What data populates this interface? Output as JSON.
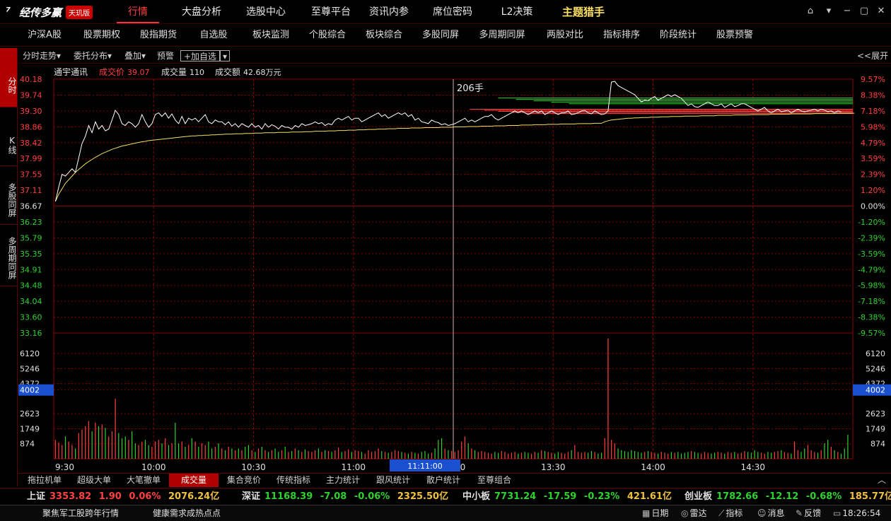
{
  "app": {
    "logo_text": "经传多赢",
    "badge": "天玑版"
  },
  "top_nav": [
    "行情",
    "大盘分析",
    "选股中心",
    "至尊平台",
    "资讯内参",
    "席位密码",
    "L2决策",
    "主题猎手"
  ],
  "sub_nav": [
    "沪深A股",
    "股票期权",
    "股指期货",
    "自选股",
    "板块监测",
    "个股综合",
    "板块综合",
    "多股同屏",
    "多周期同屏",
    "两股对比",
    "指标排序",
    "阶段统计",
    "股票预警"
  ],
  "left_tabs": [
    "分时",
    "K线",
    "多股同屏",
    "多周期同屏"
  ],
  "toolbar": {
    "fenshi": "分时走势",
    "weituo": "委托分布",
    "diejia": "叠加",
    "yujing": "预警",
    "add_self": "+加自选",
    "expand": "<<展开"
  },
  "info": {
    "stock_name": "通宇通讯",
    "price_label": "成交价",
    "price": "39.07",
    "volume_label": "成交量",
    "volume": "110",
    "amount_label": "成交额",
    "amount": "42.68万元"
  },
  "cursor": {
    "label": "206手",
    "time": "11:11:00"
  },
  "chart_data": {
    "type": "line",
    "title": "通宇通讯 分时走势",
    "prev_close": 36.67,
    "ylim": [
      33.16,
      40.18
    ],
    "price_ticks": [
      "40.18",
      "39.74",
      "39.30",
      "38.86",
      "38.42",
      "37.99",
      "37.55",
      "37.11",
      "36.67",
      "36.23",
      "35.79",
      "35.35",
      "34.91",
      "34.48",
      "34.04",
      "33.60",
      "33.16"
    ],
    "pct_ticks": [
      "9.57%",
      "8.38%",
      "7.18%",
      "5.98%",
      "4.79%",
      "3.59%",
      "2.39%",
      "1.20%",
      "0.00%",
      "-1.20%",
      "-2.39%",
      "-3.59%",
      "-4.79%",
      "-5.98%",
      "-7.18%",
      "-8.38%",
      "-9.57%"
    ],
    "volume_ticks": [
      "6120",
      "5246",
      "4372",
      "4002",
      "2623",
      "1749",
      "874"
    ],
    "volume_max": 6991,
    "x_ticks": [
      "9:30",
      "10:00",
      "10:30",
      "11:00",
      "13:00",
      "13:30",
      "14:00",
      "14:30"
    ],
    "minutes": 240,
    "price": [
      36.8,
      37.2,
      37.55,
      37.5,
      37.6,
      37.7,
      37.6,
      38.0,
      38.4,
      38.6,
      38.9,
      38.7,
      39.0,
      38.8,
      38.9,
      38.75,
      38.8,
      39.05,
      39.32,
      39.2,
      38.95,
      38.9,
      39.0,
      38.95,
      38.85,
      38.95,
      39.2,
      39.0,
      38.85,
      38.95,
      39.2,
      39.25,
      39.15,
      39.25,
      39.1,
      39.22,
      39.05,
      38.95,
      39.15,
      38.95,
      39.1,
      39.05,
      39.1,
      39.0,
      39.1,
      39.2,
      39.0,
      38.95,
      39.05,
      39.0,
      39.0,
      38.92,
      39.0,
      38.88,
      38.95,
      38.85,
      38.95,
      38.9,
      38.85,
      38.95,
      38.85,
      38.9,
      38.8,
      38.95,
      38.85,
      38.92,
      38.88,
      38.8,
      38.9,
      38.85,
      38.85,
      38.8,
      38.9,
      38.85,
      38.95,
      38.9,
      38.92,
      38.95,
      39.0,
      38.95,
      38.98,
      38.9,
      38.95,
      38.92,
      39.05,
      39.1,
      39.05,
      39.1,
      39.15,
      39.05,
      39.1,
      39.1,
      39.0,
      39.05,
      39.1,
      39.15,
      39.2,
      39.25,
      39.15,
      39.2,
      39.1,
      39.15,
      39.2,
      39.25,
      39.2,
      39.25,
      39.15,
      39.2,
      39.05,
      39.1,
      39.0,
      38.98,
      38.95,
      39.05,
      39.0,
      38.98,
      38.92,
      38.95,
      38.9,
      38.92,
      38.95,
      39.0,
      39.05,
      39.1,
      39.0,
      39.05,
      39.0,
      39.05,
      39.1,
      39.15,
      39.15,
      39.2,
      39.1,
      39.05,
      39.1,
      39.15,
      39.2,
      39.25,
      39.3,
      39.25,
      39.3,
      39.25,
      39.2,
      39.25,
      39.3,
      39.25,
      39.3,
      39.2,
      39.25,
      39.3,
      39.25,
      39.2,
      39.25,
      39.25,
      39.3,
      39.2,
      39.22,
      39.25,
      39.3,
      39.32,
      39.25,
      39.22,
      39.3,
      39.25,
      39.2,
      39.22,
      39.3,
      40.1,
      40.12,
      40.0,
      39.95,
      39.9,
      39.85,
      39.8,
      39.75,
      39.65,
      39.55,
      39.6,
      39.58,
      39.65,
      39.7,
      39.6,
      39.65,
      39.7,
      39.75,
      39.7,
      39.75,
      39.7,
      39.65,
      39.55,
      39.45,
      39.5,
      39.42,
      39.4,
      39.45,
      39.5,
      39.55,
      39.5,
      39.45,
      39.45,
      39.5,
      39.4,
      39.45,
      39.5,
      39.42,
      39.45,
      39.5,
      39.5,
      39.45,
      39.4,
      39.35,
      39.3,
      39.35,
      39.4,
      39.3,
      39.25,
      39.3,
      39.35,
      39.28,
      39.3,
      39.32,
      39.25,
      39.3,
      39.35,
      39.3,
      39.28,
      39.3,
      39.32,
      39.35,
      39.3,
      39.35,
      39.32,
      39.28,
      39.3,
      39.25,
      39.3,
      39.28
    ],
    "avg": [
      36.8,
      37.0,
      37.15,
      37.3,
      37.4,
      37.5,
      37.6,
      37.68,
      37.76,
      37.84,
      37.9,
      37.96,
      38.02,
      38.07,
      38.12,
      38.16,
      38.2,
      38.24,
      38.27,
      38.3,
      38.33,
      38.35,
      38.37,
      38.39,
      38.41,
      38.43,
      38.45,
      38.46,
      38.48,
      38.49,
      38.5,
      38.51,
      38.52,
      38.53,
      38.54,
      38.55,
      38.56,
      38.57,
      38.58,
      38.59,
      38.6,
      38.61,
      38.61,
      38.62,
      38.62,
      38.63,
      38.63,
      38.64,
      38.64,
      38.65,
      38.65,
      38.66,
      38.66,
      38.66,
      38.67,
      38.67,
      38.67,
      38.68,
      38.68,
      38.68,
      38.69,
      38.69,
      38.69,
      38.7,
      38.7,
      38.7,
      38.7,
      38.71,
      38.71,
      38.71,
      38.71,
      38.72,
      38.72,
      38.72,
      38.72,
      38.73,
      38.73,
      38.73,
      38.74,
      38.74,
      38.74,
      38.74,
      38.75,
      38.75,
      38.75,
      38.76,
      38.76,
      38.76,
      38.77,
      38.77,
      38.77,
      38.78,
      38.78,
      38.78,
      38.79,
      38.79,
      38.79,
      38.8,
      38.8,
      38.8,
      38.81,
      38.81,
      38.81,
      38.82,
      38.82,
      38.82,
      38.82,
      38.83,
      38.83,
      38.83,
      38.83,
      38.84,
      38.84,
      38.84,
      38.84,
      38.84,
      38.85,
      38.85,
      38.85,
      38.85,
      38.86,
      38.86,
      38.86,
      38.86,
      38.87,
      38.87,
      38.87,
      38.87,
      38.88,
      38.88,
      38.88,
      38.88,
      38.89,
      38.89,
      38.89,
      38.89,
      38.9,
      38.9,
      38.9,
      38.9,
      38.91,
      38.91,
      38.91,
      38.91,
      38.92,
      38.92,
      38.92,
      38.92,
      38.93,
      38.93,
      38.93,
      38.93,
      38.94,
      38.94,
      38.94,
      38.94,
      38.94,
      38.95,
      38.95,
      38.95,
      38.95,
      38.95,
      38.96,
      38.96,
      38.96,
      39.0,
      39.03,
      39.05,
      39.06,
      39.07,
      39.08,
      39.09,
      39.1,
      39.1,
      39.11,
      39.11,
      39.12,
      39.12,
      39.12,
      39.13,
      39.13,
      39.13,
      39.14,
      39.14,
      39.14,
      39.15,
      39.15,
      39.15,
      39.15,
      39.16,
      39.16,
      39.16,
      39.16,
      39.16,
      39.17,
      39.17,
      39.17,
      39.17,
      39.17,
      39.18,
      39.18,
      39.18,
      39.18,
      39.18,
      39.19,
      39.19,
      39.19,
      39.19,
      39.19,
      39.2,
      39.2,
      39.2,
      39.2,
      39.2,
      39.2,
      39.21,
      39.21,
      39.21,
      39.21,
      39.21,
      39.21,
      39.22,
      39.22,
      39.22,
      39.22,
      39.22,
      39.22,
      39.22,
      39.23,
      39.23,
      39.23,
      39.23,
      39.23,
      39.23,
      39.23,
      39.24,
      39.24,
      39.24,
      39.24,
      39.24,
      39.24
    ],
    "volume": [
      1100,
      950,
      800,
      1300,
      1000,
      800,
      600,
      1500,
      1700,
      1900,
      2200,
      1600,
      2100,
      1900,
      2000,
      1800,
      1300,
      1600,
      3500,
      1500,
      1200,
      1300,
      1100,
      1600,
      900,
      800,
      1000,
      1100,
      800,
      700,
      1000,
      1100,
      900,
      1200,
      800,
      900,
      2100,
      900,
      1000,
      700,
      800,
      1200,
      1000,
      700,
      900,
      800,
      1000,
      600,
      700,
      900,
      600,
      500,
      700,
      600,
      500,
      600,
      500,
      700,
      800,
      500,
      400,
      600,
      700,
      500,
      400,
      500,
      600,
      400,
      500,
      700,
      400,
      450,
      600,
      500,
      400,
      550,
      450,
      400,
      500,
      600,
      400,
      500,
      450,
      400,
      500,
      650,
      400,
      450,
      550,
      400,
      500,
      450,
      400,
      300,
      500,
      400,
      450,
      600,
      450,
      400,
      350,
      400,
      500,
      450,
      400,
      350,
      300,
      400,
      350,
      300,
      400,
      450,
      300,
      350,
      600,
      1100,
      1200,
      600,
      500,
      450,
      400,
      500,
      1000,
      1300,
      900,
      600,
      500,
      400,
      450,
      400,
      350,
      300,
      400,
      350,
      450,
      400,
      300,
      350,
      400,
      300,
      350,
      400,
      350,
      300,
      400,
      350,
      500,
      450,
      400,
      350,
      300,
      400,
      350,
      300,
      400,
      500,
      800,
      400,
      350,
      400,
      350,
      450,
      400,
      300,
      350,
      1200,
      7000,
      1100,
      900,
      600,
      500,
      450,
      400,
      500,
      450,
      400,
      350,
      400,
      450,
      400,
      350,
      300,
      400,
      350,
      300,
      400,
      350,
      400,
      300,
      350,
      400,
      450,
      400,
      350,
      300,
      400,
      350,
      300,
      350,
      400,
      350,
      300,
      400,
      350,
      400,
      300,
      350,
      450,
      400,
      350,
      500,
      400,
      350,
      300,
      400,
      350,
      400,
      450,
      500,
      400,
      350,
      300,
      1000,
      500,
      400,
      600,
      800,
      500,
      400,
      350,
      500,
      900,
      1100,
      700,
      500,
      400,
      300,
      600,
      1400
    ],
    "ask_levels": [
      39.66,
      39.62,
      39.58,
      39.54,
      39.5
    ],
    "bid_levels": [
      39.35,
      39.32,
      39.29,
      39.26,
      39.23
    ]
  },
  "bottom_tabs": [
    "拖拉机单",
    "超级大单",
    "大笔撤单",
    "成交量",
    "集合竞价",
    "传统指标",
    "主力统计",
    "跟风统计",
    "散户统计",
    "至尊组合"
  ],
  "ticker": [
    {
      "name": "上证",
      "value": "3353.82",
      "change": "1.90",
      "pct": "0.06%",
      "amount": "2076.24亿"
    },
    {
      "name": "深证",
      "value": "11168.39",
      "change": "-7.08",
      "pct": "-0.06%",
      "amount": "2325.50亿"
    },
    {
      "name": "中小板",
      "value": "7731.24",
      "change": "-17.59",
      "pct": "-0.23%",
      "amount": "421.61亿"
    },
    {
      "name": "创业板",
      "value": "1782.66",
      "change": "-12.12",
      "pct": "-0.68%",
      "amount": "185.77亿"
    }
  ],
  "status": {
    "news1": "聚焦军工股跨年行情",
    "news2": "健康需求成热点点",
    "date": "日期",
    "radar": "雷达",
    "indicator": "指标",
    "message": "消息",
    "feedback": "反馈",
    "time": "18:26:54"
  },
  "colors": {
    "up": "#ff4040",
    "down": "#30d030",
    "grid": "#8b0000",
    "avg": "#f0e060",
    "price": "#ffffff"
  }
}
